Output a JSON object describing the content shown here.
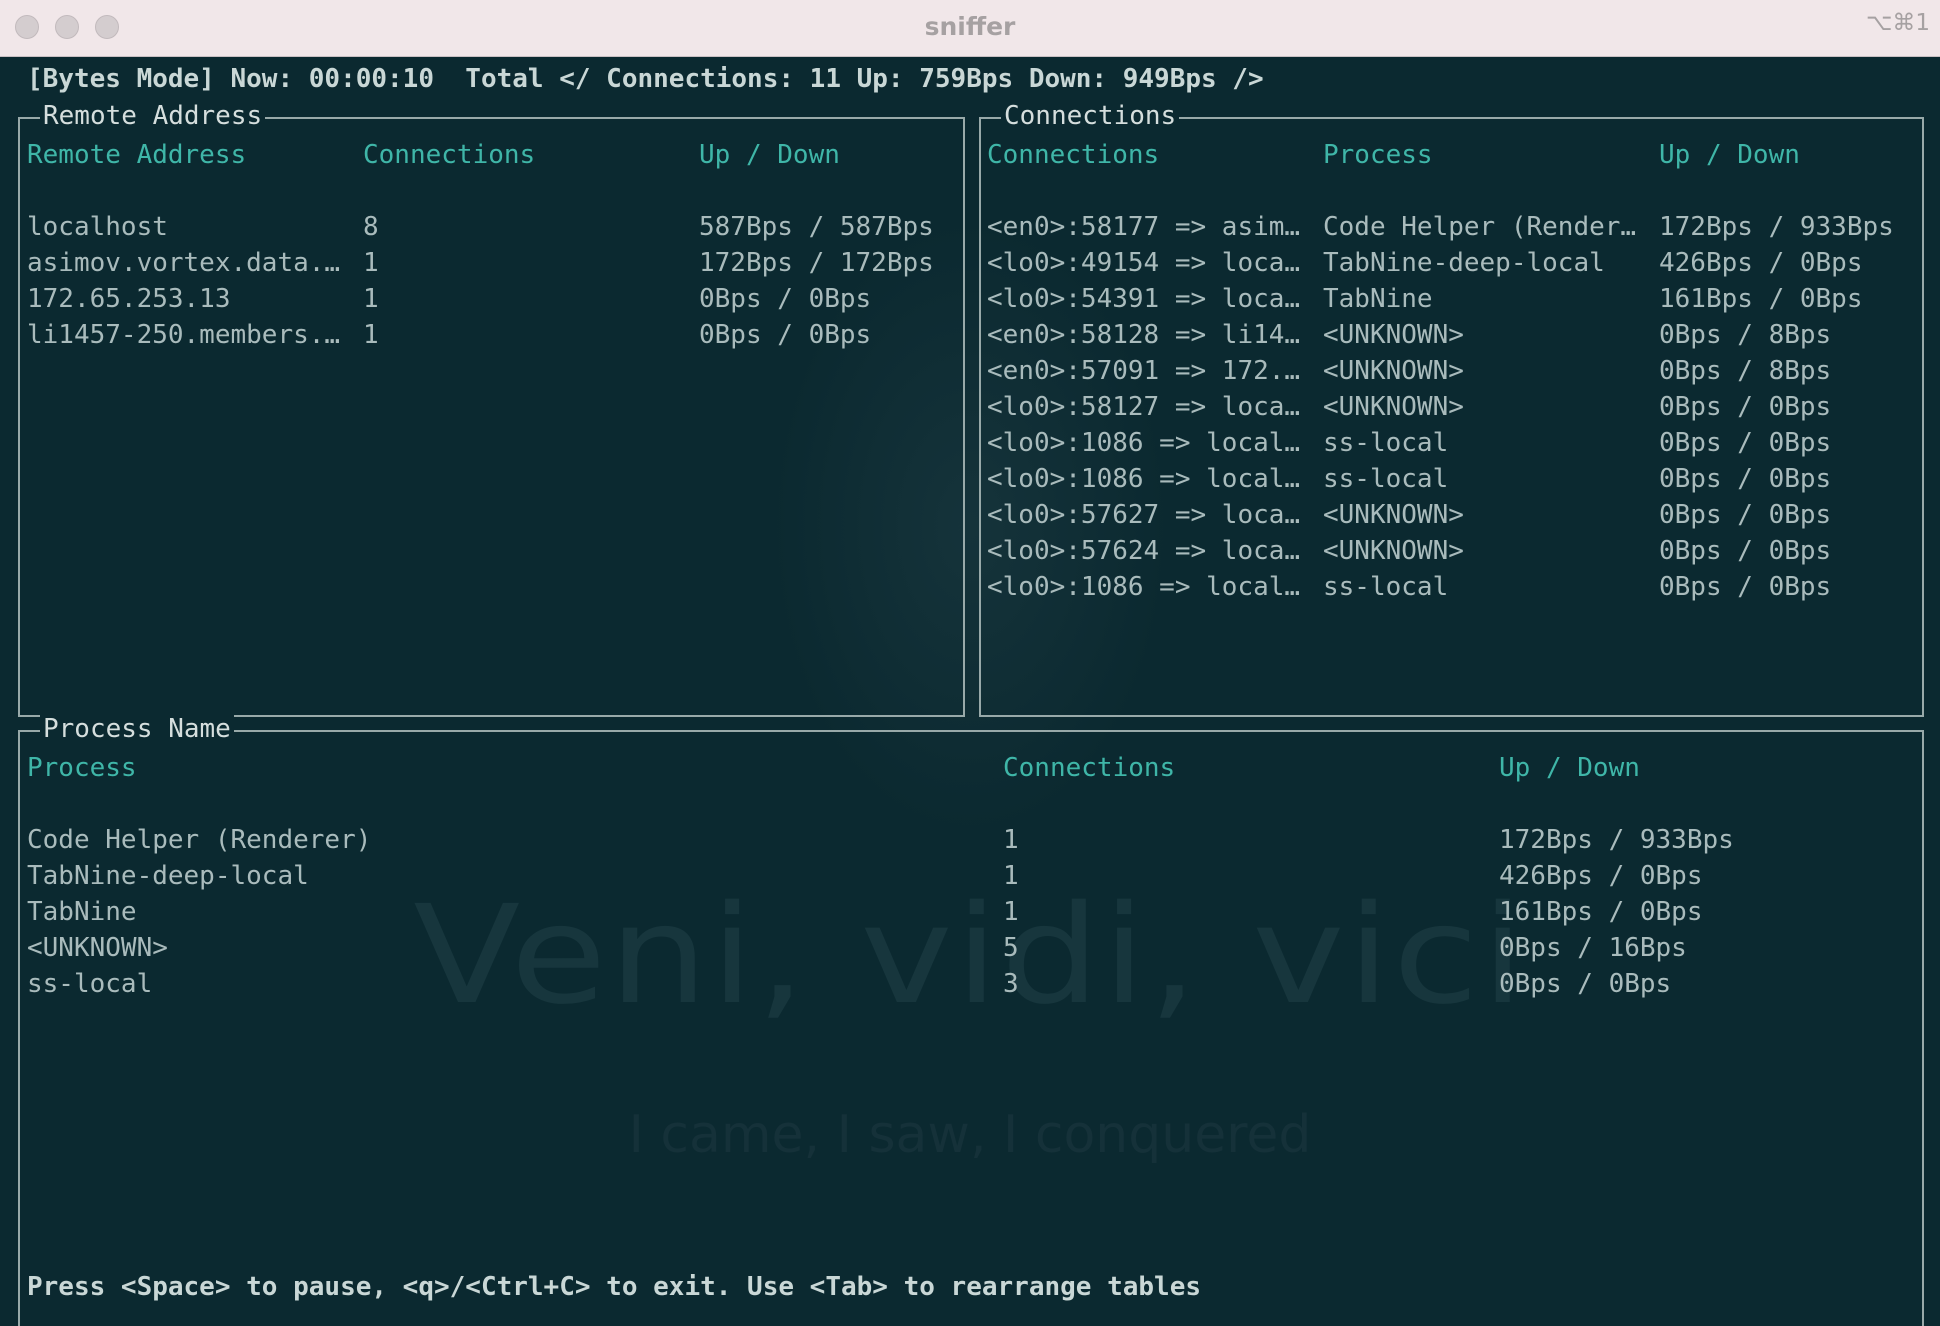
{
  "window": {
    "title": "sniffer",
    "shortcut": "⌥⌘1"
  },
  "status_line": "[Bytes Mode] Now: 00:00:10  Total </ Connections: 11 Up: 759Bps Down: 949Bps />",
  "remote_panel": {
    "title": "Remote Address",
    "headers": [
      "Remote Address",
      "Connections",
      "Up / Down"
    ],
    "rows": [
      [
        "localhost",
        "8",
        "587Bps / 587Bps"
      ],
      [
        "asimov.vortex.data.…",
        "1",
        "172Bps / 172Bps"
      ],
      [
        "172.65.253.13",
        "1",
        "0Bps / 0Bps"
      ],
      [
        "li1457-250.members.…",
        "1",
        "0Bps / 0Bps"
      ]
    ]
  },
  "connections_panel": {
    "title": "Connections",
    "headers": [
      "Connections",
      "Process",
      "Up / Down"
    ],
    "rows": [
      [
        "<en0>:58177 => asim…",
        "Code Helper (Render…",
        "172Bps / 933Bps"
      ],
      [
        "<lo0>:49154 => loca…",
        "TabNine-deep-local",
        "426Bps / 0Bps"
      ],
      [
        "<lo0>:54391 => loca…",
        "TabNine",
        "161Bps / 0Bps"
      ],
      [
        "<en0>:58128 => li14…",
        "<UNKNOWN>",
        "0Bps / 8Bps"
      ],
      [
        "<en0>:57091 => 172.…",
        "<UNKNOWN>",
        "0Bps / 8Bps"
      ],
      [
        "<lo0>:58127 => loca…",
        "<UNKNOWN>",
        "0Bps / 0Bps"
      ],
      [
        "<lo0>:1086 => local…",
        "ss-local",
        "0Bps / 0Bps"
      ],
      [
        "<lo0>:1086 => local…",
        "ss-local",
        "0Bps / 0Bps"
      ],
      [
        "<lo0>:57627 => loca…",
        "<UNKNOWN>",
        "0Bps / 0Bps"
      ],
      [
        "<lo0>:57624 => loca…",
        "<UNKNOWN>",
        "0Bps / 0Bps"
      ],
      [
        "<lo0>:1086 => local…",
        "ss-local",
        "0Bps / 0Bps"
      ]
    ]
  },
  "process_panel": {
    "title": "Process Name",
    "headers": [
      "Process",
      "Connections",
      "Up / Down"
    ],
    "rows": [
      [
        "Code Helper (Renderer)",
        "1",
        "172Bps / 933Bps"
      ],
      [
        "TabNine-deep-local",
        "1",
        "426Bps / 0Bps"
      ],
      [
        "TabNine",
        "1",
        "161Bps / 0Bps"
      ],
      [
        "<UNKNOWN>",
        "5",
        "0Bps / 16Bps"
      ],
      [
        "ss-local",
        "3",
        "0Bps / 0Bps"
      ]
    ]
  },
  "wallpaper": {
    "headline": "Veni, vidi, vici",
    "tagline": "I came, I saw, I conquered"
  },
  "help_line": "Press <Space> to pause, <q>/<Ctrl+C> to exit. Use <Tab> to rearrange tables",
  "colors": {
    "terminal_bg": "#0b2930",
    "header_text": "#3fb6a8",
    "cell_text": "#a9bbbc",
    "border": "#98a9a9"
  }
}
